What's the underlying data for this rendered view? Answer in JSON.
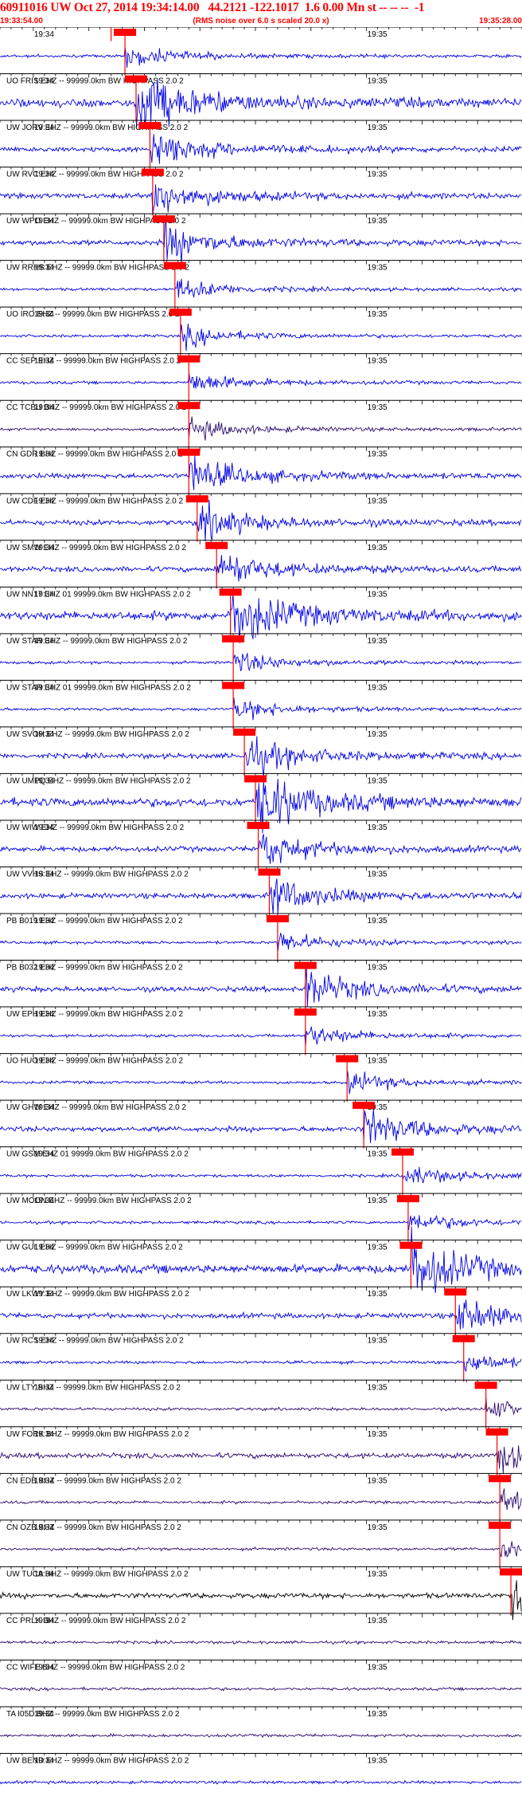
{
  "header": {
    "title": "60911016 UW Oct 27, 2014 19:34:14.00   44.2121 -122.1017  1.6 0.00 Mn st -- -- --  -1",
    "start_time": "19:33:54.00",
    "rms_note": "(RMS noise over 6.0 s scaled 20.0 x)",
    "end_time": "19:35:28.00"
  },
  "colors": {
    "header_text": "#ff0000",
    "pick_marker": "#ff0000",
    "trace_blue": "#0000e6",
    "trace_purple": "#2a0a6e",
    "trace_black": "#000000"
  },
  "chart_data": {
    "type": "seismogram",
    "time_window": [
      "19:33:54.00",
      "19:35:28.00"
    ],
    "time_labels": [
      "19:34",
      "19:35"
    ],
    "origin_time": "19:34:14.00",
    "traces": [
      {
        "label": "",
        "color": "blue",
        "amp": "low",
        "pick": "19:34:16.5"
      },
      {
        "label": "UO FRIS EHZ -- 99999.0km BW  HIGHPASS  2.0  2",
        "color": "blue",
        "amp": "large",
        "pick": "19:34:18.5"
      },
      {
        "label": "UW JORV EHZ -- 99999.0km BW  HIGHPASS  2.0  2",
        "color": "blue",
        "amp": "medium",
        "pick": "19:34:21.0"
      },
      {
        "label": "UW RVC EHZ -- 99999.0km BW  HIGHPASS  2.0  2",
        "color": "blue",
        "amp": "medium",
        "pick": "19:34:21.5"
      },
      {
        "label": "UW WPO EHZ -- 99999.0km BW  HIGHPASS  2.0  2",
        "color": "blue",
        "amp": "medium",
        "pick": "19:34:23.5"
      },
      {
        "label": "UW RRHS EHZ -- 99999.0km BW  HIGHPASS  2.0  2",
        "color": "blue",
        "amp": "low",
        "pick": "19:34:25.5"
      },
      {
        "label": "UO IRO EHZ -- 99999.0km BW  HIGHPASS  2.0  2",
        "color": "blue",
        "amp": "low",
        "pick": "19:34:26.5"
      },
      {
        "label": "CC SEP EHZ -- 99999.0km BW  HIGHPASS  2.0  2",
        "color": "blue",
        "amp": "low",
        "pick": "19:34:28.0"
      },
      {
        "label": "CC TCBU BHZ -- 99999.0km BW  HIGHPASS  2.0  2",
        "color": "purple",
        "amp": "low",
        "pick": "19:34:28.0"
      },
      {
        "label": "CN GDR BHZ -- 99999.0km BW  HIGHPASS  2.0  2",
        "color": "blue",
        "amp": "medium",
        "pick": "19:34:28.0"
      },
      {
        "label": "UW CDF EHZ -- 99999.0km BW  HIGHPASS  2.0  2",
        "color": "blue",
        "amp": "medium",
        "pick": "19:34:29.5"
      },
      {
        "label": "UW SMW EHZ -- 99999.0km BW  HIGHPASS  2.0  2",
        "color": "blue",
        "amp": "medium",
        "pick": "19:34:33.0"
      },
      {
        "label": "UW NN17 EHZ 01 99999.0km BW  HIGHPASS  2.0  2",
        "color": "blue",
        "amp": "large",
        "pick": "19:34:35.5"
      },
      {
        "label": "UW STAR EHZ -- 99999.0km BW  HIGHPASS  2.0  2",
        "color": "blue",
        "amp": "low",
        "pick": "19:34:36.0"
      },
      {
        "label": "UW STAR EHZ 01 99999.0km BW  HIGHPASS  2.0  2",
        "color": "blue",
        "amp": "low",
        "pick": "19:34:36.0"
      },
      {
        "label": "UW SVOH EHZ -- 99999.0km BW  HIGHPASS  2.0  2",
        "color": "blue",
        "amp": "medium",
        "pick": "19:34:38.0"
      },
      {
        "label": "UW UMPQ EHZ -- 99999.0km BW  HIGHPASS  2.0  2",
        "color": "blue",
        "amp": "large",
        "pick": "19:34:40.0"
      },
      {
        "label": "UW WIW EHZ -- 99999.0km BW  HIGHPASS  2.0  2",
        "color": "blue",
        "amp": "medium",
        "pick": "19:34:40.5"
      },
      {
        "label": "UW VVHS EHZ -- 99999.0km BW  HIGHPASS  2.0  2",
        "color": "blue",
        "amp": "medium",
        "pick": "19:34:42.5"
      },
      {
        "label": "PB B019 EHZ -- 99999.0km BW  HIGHPASS  2.0  2",
        "color": "blue",
        "amp": "low",
        "pick": "19:34:44.0"
      },
      {
        "label": "PB B032 EHZ -- 99999.0km BW  HIGHPASS  2.0  2",
        "color": "blue",
        "amp": "medium",
        "pick": "19:34:49.0"
      },
      {
        "label": "UW EPH EHZ -- 99999.0km BW  HIGHPASS  2.0  2",
        "color": "blue",
        "amp": "low",
        "pick": "19:34:49.0"
      },
      {
        "label": "UO HUO EHZ -- 99999.0km BW  HIGHPASS  2.0  2",
        "color": "blue",
        "amp": "low",
        "pick": "19:34:56.5"
      },
      {
        "label": "UW GHW EHZ -- 99999.0km BW  HIGHPASS  2.0  2",
        "color": "blue",
        "amp": "medium",
        "pick": "19:34:59.5"
      },
      {
        "label": "UW GSM EHZ 01 99999.0km BW  HIGHPASS  2.0  2",
        "color": "blue",
        "amp": "low",
        "pick": "19:35:06.5"
      },
      {
        "label": "UW MOON EHZ -- 99999.0km BW  HIGHPASS  2.0  2",
        "color": "blue",
        "amp": "low",
        "pick": "19:35:07.5"
      },
      {
        "label": "UW GUL EHZ -- 99999.0km BW  HIGHPASS  2.0  2",
        "color": "blue",
        "amp": "large",
        "pick": "19:35:08.0"
      },
      {
        "label": "UW LKWY EHZ -- 99999.0km BW  HIGHPASS  2.0  2",
        "color": "blue",
        "amp": "medium",
        "pick": "19:35:16.0"
      },
      {
        "label": "UW RCS EHZ -- 99999.0km BW  HIGHPASS  2.0  2",
        "color": "blue",
        "amp": "low",
        "pick": "19:35:17.5"
      },
      {
        "label": "UW LTY BHZ -- 99999.0km BW  HIGHPASS  2.0  2",
        "color": "purple",
        "amp": "low",
        "pick": "19:35:21.5"
      },
      {
        "label": "UW FORK BHZ -- 99999.0km BW  HIGHPASS  2.0  2",
        "color": "purple",
        "amp": "medium",
        "pick": "19:35:23.5"
      },
      {
        "label": "CN EDB BHZ -- 99999.0km BW  HIGHPASS  2.0  2",
        "color": "purple",
        "amp": "low",
        "pick": "19:35:24.0"
      },
      {
        "label": "CN OZB BHZ -- 99999.0km BW  HIGHPASS  2.0  2",
        "color": "purple",
        "amp": "low",
        "pick": "19:35:24.0"
      },
      {
        "label": "UW TUCA HHZ -- 99999.0km BW  HIGHPASS  2.0  2",
        "color": "black",
        "amp": "medium",
        "pick": "19:35:26.0"
      },
      {
        "label": "CC PRLK BHZ -- 99999.0km BW  HIGHPASS  2.0  2",
        "color": "purple",
        "amp": "low",
        "pick": null
      },
      {
        "label": "CC WIFE BHZ -- 99999.0km BW  HIGHPASS  2.0  2",
        "color": "purple",
        "amp": "low",
        "pick": null
      },
      {
        "label": "TA I05D BHZ -- 99999.0km BW  HIGHPASS  2.0  2",
        "color": "purple",
        "amp": "low",
        "pick": null
      },
      {
        "label": "UW BEND EHZ -- 99999.0km BW  HIGHPASS  2.0  2",
        "color": "blue",
        "amp": "low",
        "pick": null
      }
    ]
  }
}
